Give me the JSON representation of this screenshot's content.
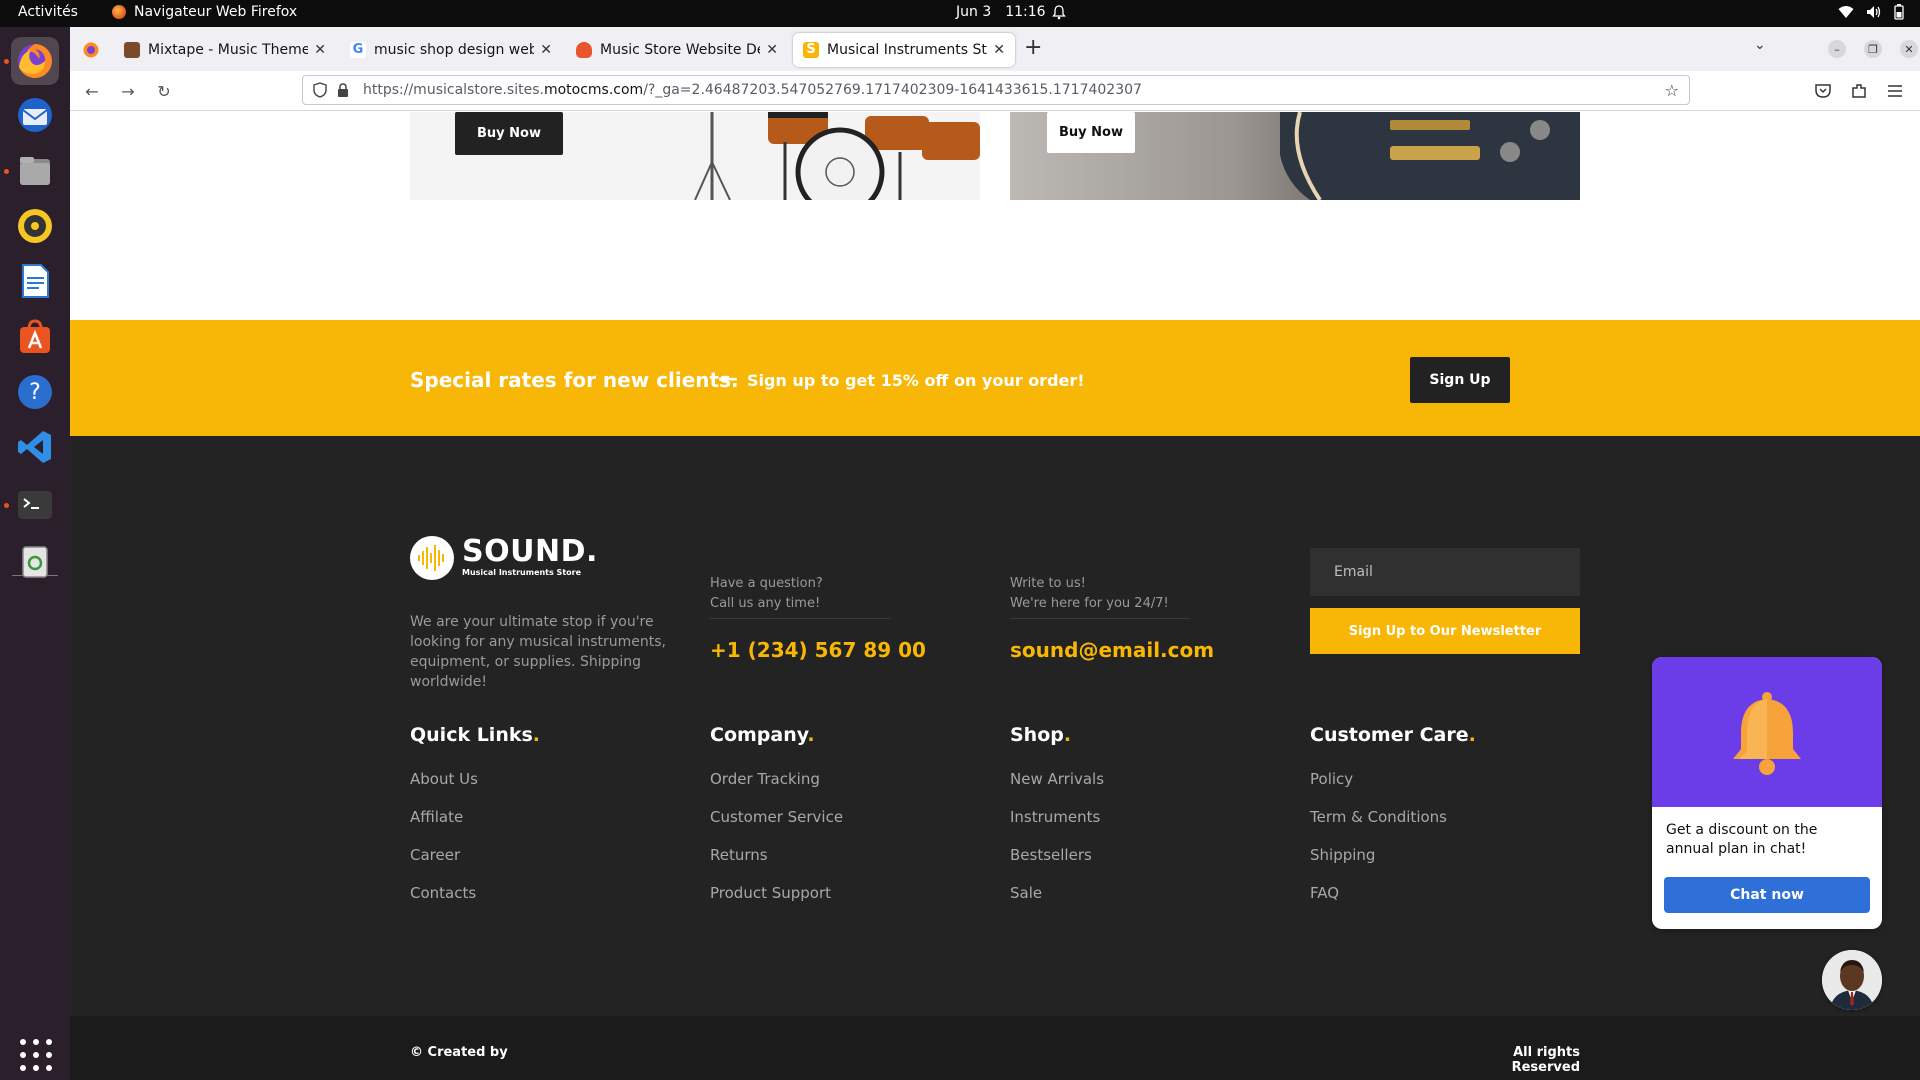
{
  "system": {
    "activities": "Activités",
    "app_name": "Navigateur Web Firefox",
    "date": "Jun 3",
    "time": "11:16"
  },
  "tabs": [
    {
      "title": "Mixtape - Music Theme f",
      "fav_color": "#7a4a2a"
    },
    {
      "title": "music shop design web -",
      "fav_color": "#4285f4"
    },
    {
      "title": "Music Store Website Des",
      "fav_color": "#e8552d"
    },
    {
      "title": "Musical Instruments Stor",
      "fav_color": "#f8b706"
    }
  ],
  "url": {
    "prefix": "https://musicalstore.sites.",
    "domain": "motocms.com",
    "path": "/?_ga=2.46487203.547052769.1717402309-1641433615.1717402307"
  },
  "cards": {
    "buy_now_1": "Buy Now",
    "buy_now_2": "Buy Now"
  },
  "promo": {
    "headline": "Special rates for new clients.",
    "dash": "—",
    "subline": "Sign up to get 15% off on your order!",
    "button": "Sign Up"
  },
  "footer": {
    "brand": "SOUND.",
    "brand_sub": "Musical Instruments Store",
    "about": "We are your ultimate stop if you're looking for any musical instruments, equipment, or supplies. Shipping worldwide!",
    "phone_label_1": "Have a question?",
    "phone_label_2": "Call us any time!",
    "phone": "+1 (234) 567 89 00",
    "email_label_1": "Write to us!",
    "email_label_2": "We're here for you 24/7!",
    "email": "sound@email.com",
    "email_placeholder": "Email",
    "newsletter_button": "Sign Up to Our Newsletter",
    "columns": [
      {
        "title": "Quick Links",
        "links": [
          "About Us",
          "Affilate",
          "Career",
          "Contacts"
        ]
      },
      {
        "title": "Company",
        "links": [
          "Order Tracking",
          "Customer Service",
          "Returns",
          "Product Support"
        ]
      },
      {
        "title": "Shop",
        "links": [
          "New Arrivals",
          "Instruments",
          "Bestsellers",
          "Sale"
        ]
      },
      {
        "title": "Customer Care",
        "links": [
          "Policy",
          "Term & Conditions",
          "Shipping",
          "FAQ"
        ]
      }
    ],
    "copyright": "© Created by",
    "rights": "All rights Reserved"
  },
  "chat": {
    "message": "Get a discount on the annual plan in chat!",
    "button": "Chat now"
  },
  "colors": {
    "accent_yellow": "#f8b706",
    "footer_bg": "#232323",
    "chat_purple": "#6a3de8",
    "chat_blue": "#2f6fd8"
  }
}
